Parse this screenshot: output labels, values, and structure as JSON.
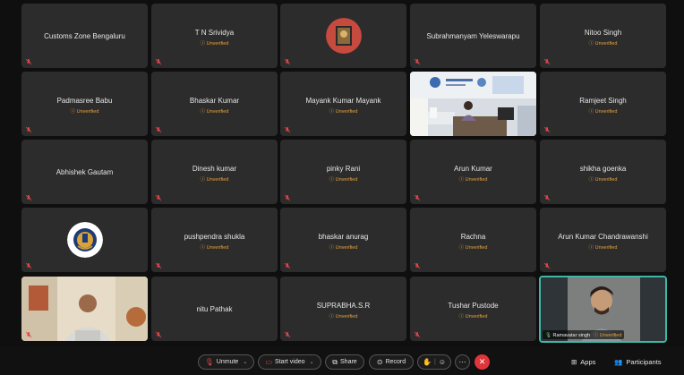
{
  "participants": [
    {
      "name": "Customs Zone Bengaluru",
      "unverified": ""
    },
    {
      "name": "T N Srividya",
      "unverified": "ⓘ Unverified"
    },
    {
      "name": "",
      "unverified": "",
      "avatar": "red-avatar"
    },
    {
      "name": "Subrahmanyam Yeleswarapu",
      "unverified": ""
    },
    {
      "name": "Nitoo Singh",
      "unverified": "ⓘ Unverified"
    },
    {
      "name": "Padmasree Babu",
      "unverified": "ⓘ Unverified"
    },
    {
      "name": "Bhaskar Kumar",
      "unverified": "ⓘ Unverified"
    },
    {
      "name": "Mayank Kumar Mayank",
      "unverified": "ⓘ Unverified"
    },
    {
      "name": "",
      "unverified": "",
      "video": "office-video"
    },
    {
      "name": "Ramjeet Singh",
      "unverified": "ⓘ Unverified"
    },
    {
      "name": "Abhishek Gautam",
      "unverified": ""
    },
    {
      "name": "Dinesh kumar",
      "unverified": "ⓘ Unverified"
    },
    {
      "name": "pinky Rani",
      "unverified": "ⓘ Unverified"
    },
    {
      "name": "Arun Kumar",
      "unverified": "ⓘ Unverified"
    },
    {
      "name": "shikha goenka",
      "unverified": "ⓘ Unverified"
    },
    {
      "name": "",
      "unverified": "",
      "avatar": "emblem-avatar"
    },
    {
      "name": "pushpendra shukla",
      "unverified": "ⓘ Unverified"
    },
    {
      "name": "bhaskar anurag",
      "unverified": "ⓘ Unverified"
    },
    {
      "name": "Rachna",
      "unverified": "ⓘ Unverified"
    },
    {
      "name": "Arun Kumar Chandrawanshi",
      "unverified": "ⓘ Unverified"
    },
    {
      "name": "",
      "unverified": "",
      "video": "man-video"
    },
    {
      "name": "nitu Pathak",
      "unverified": ""
    },
    {
      "name": "SUPRABHA.S.R",
      "unverified": "ⓘ Unverified"
    },
    {
      "name": "Tushar Pustode",
      "unverified": "ⓘ Unverified"
    },
    {
      "name": "Ramavatar singh",
      "unverified": "ⓘ Unverified",
      "video": "speaker-video",
      "active": true
    }
  ],
  "toolbar": {
    "unmute": "Unmute",
    "start_video": "Start video",
    "share": "Share",
    "record": "Record",
    "apps": "Apps",
    "participants": "Participants"
  },
  "colors": {
    "tile_bg": "#2c2c2c",
    "unverified": "#e8a33a",
    "active_border": "#3db8a6",
    "muted_red": "#e0454b",
    "end_call": "#e0353b"
  }
}
